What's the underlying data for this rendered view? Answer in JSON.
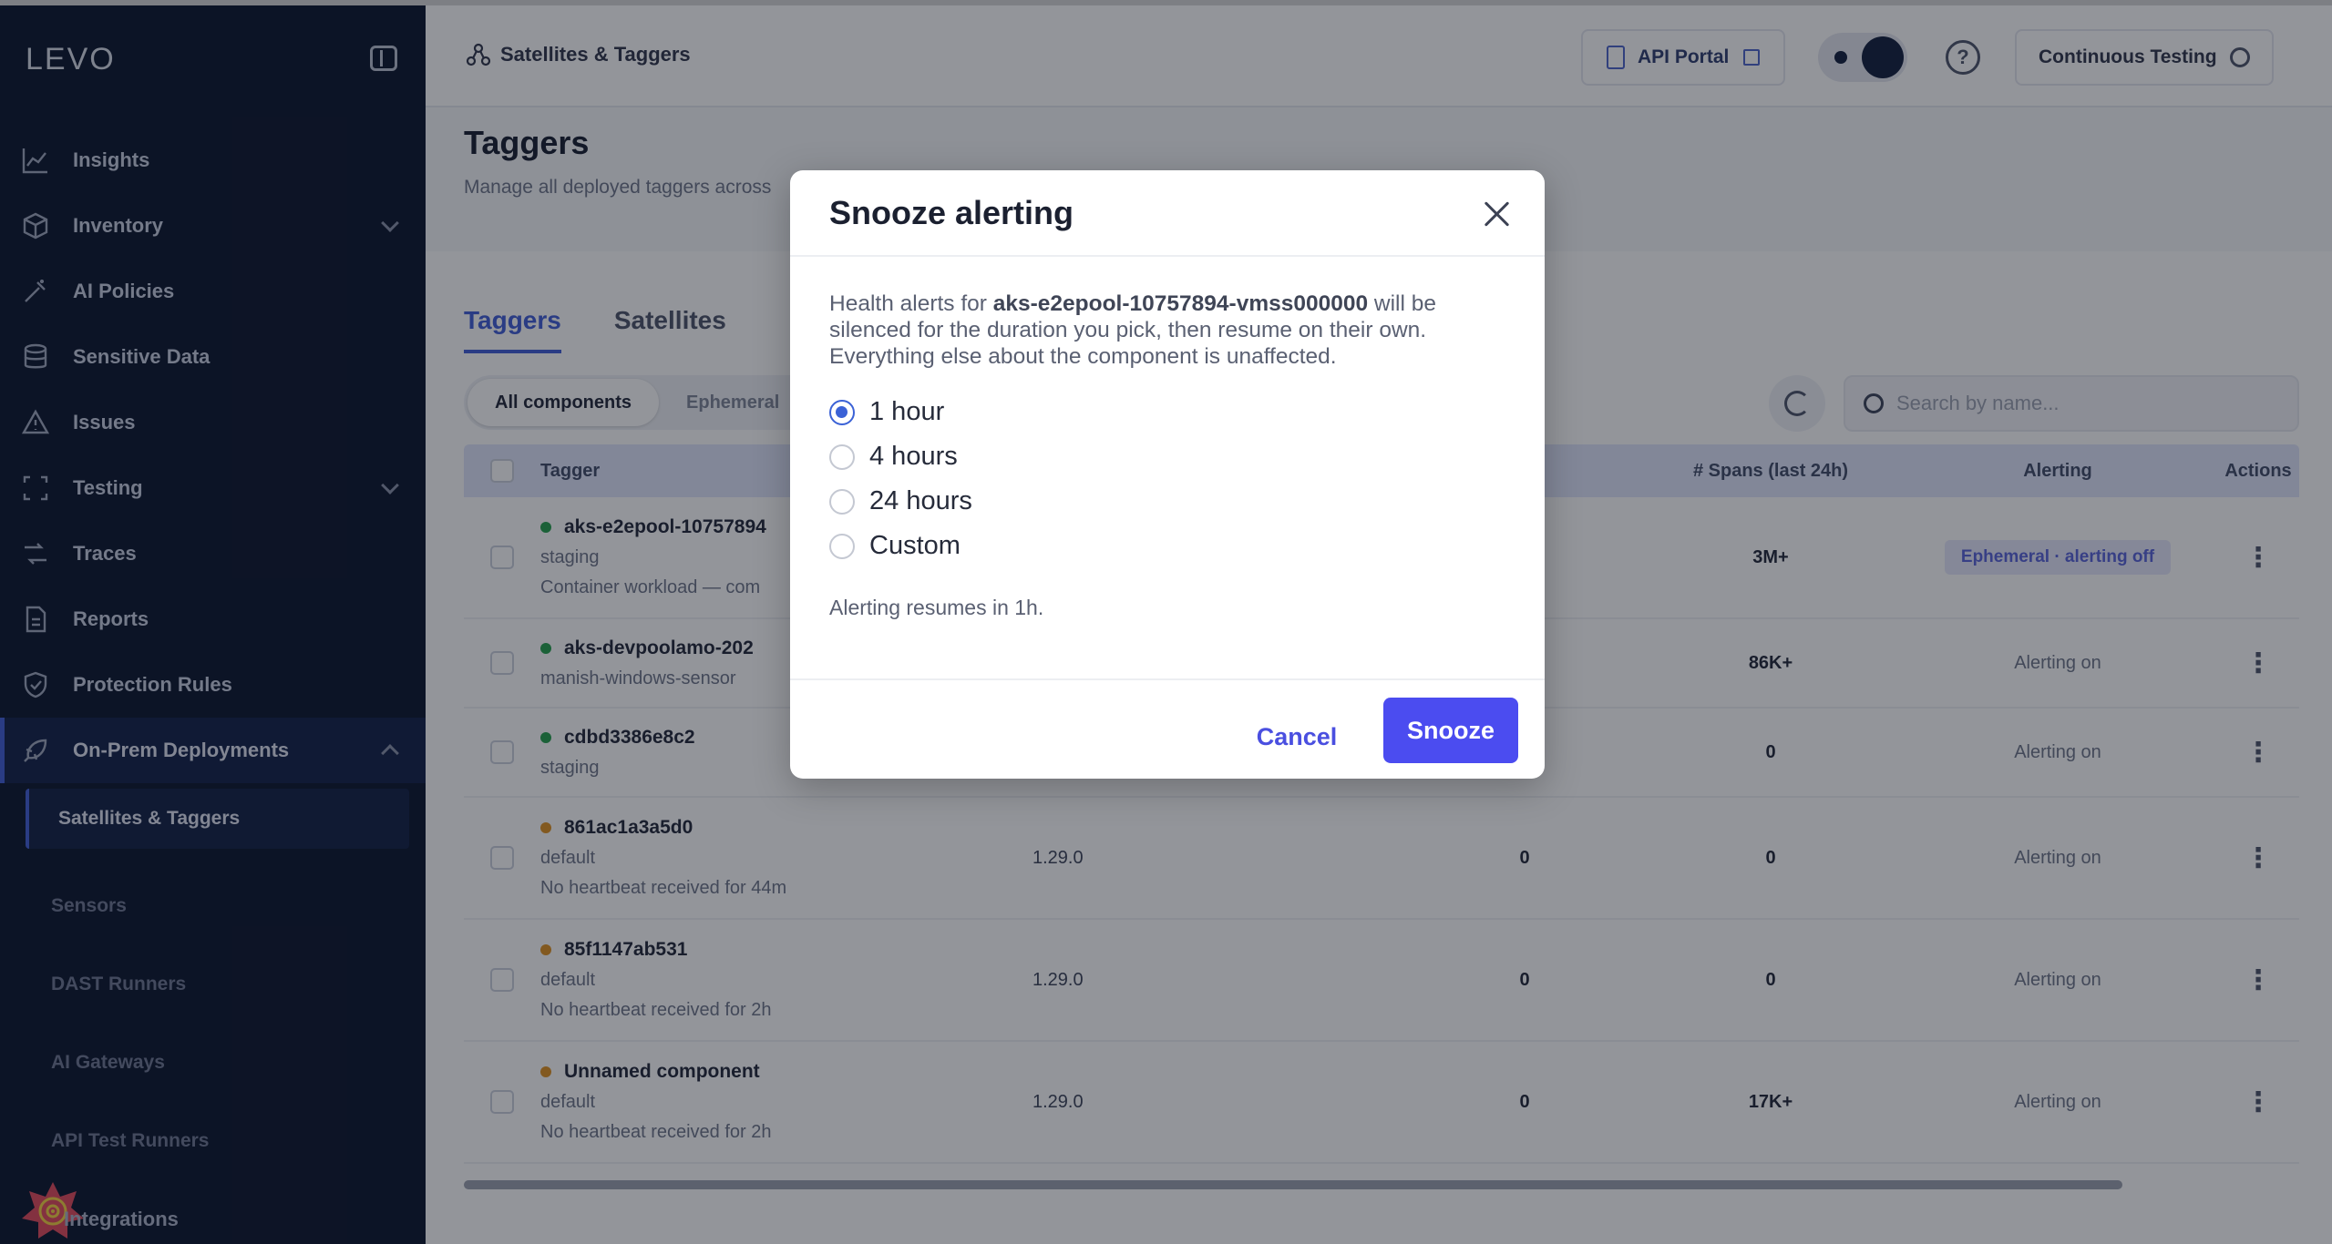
{
  "sidebar": {
    "logo": "LEVO",
    "nav": [
      {
        "label": "Insights",
        "icon": "chart-line-icon"
      },
      {
        "label": "Inventory",
        "icon": "box-icon",
        "chevron": "down"
      },
      {
        "label": "AI Policies",
        "icon": "wand-icon"
      },
      {
        "label": "Sensitive Data",
        "icon": "database-icon"
      },
      {
        "label": "Issues",
        "icon": "warning-icon"
      },
      {
        "label": "Testing",
        "icon": "scan-icon",
        "chevron": "down"
      },
      {
        "label": "Traces",
        "icon": "traces-icon"
      },
      {
        "label": "Reports",
        "icon": "report-icon"
      },
      {
        "label": "Protection Rules",
        "icon": "shield-check-icon"
      },
      {
        "label": "On-Prem Deployments",
        "icon": "rocket-icon",
        "chevron": "up"
      }
    ],
    "sub": [
      "Satellites & Taggers",
      "Sensors",
      "DAST Runners",
      "AI Gateways",
      "API Test Runners"
    ],
    "integrations": "Integrations"
  },
  "header": {
    "breadcrumb": "Satellites & Taggers",
    "api_portal": "API Portal",
    "help": "?",
    "env_button": "Continuous Testing"
  },
  "page": {
    "title": "Taggers",
    "subtitle": "Manage all deployed taggers across"
  },
  "tabs": [
    "Taggers",
    "Satellites"
  ],
  "filters": [
    "All components",
    "Ephemeral"
  ],
  "search": {
    "placeholder": "Search by name..."
  },
  "table": {
    "headers": {
      "name": "Tagger",
      "spans": "# Spans (last 24h)",
      "alerting": "Alerting",
      "actions": "Actions"
    },
    "rows": [
      {
        "name": "aks-e2epool-10757894",
        "env": "staging",
        "note": "Container workload — com",
        "version": "",
        "col_x": "",
        "spans": "3M+",
        "alerting": "Ephemeral · alerting off",
        "status": "#22a04b",
        "chip": true
      },
      {
        "name": "aks-devpoolamo-202",
        "env": "manish-windows-sensor",
        "note": "",
        "version": "",
        "col_x": "",
        "spans": "86K+",
        "alerting": "Alerting on",
        "status": "#22a04b",
        "chip": false
      },
      {
        "name": "cdbd3386e8c2",
        "env": "staging",
        "note": "",
        "version": "",
        "col_x": "",
        "spans": "0",
        "alerting": "Alerting on",
        "status": "#22a04b",
        "chip": false
      },
      {
        "name": "861ac1a3a5d0",
        "env": "default",
        "note": "No heartbeat received for 44m",
        "version": "1.29.0",
        "col_x": "0",
        "spans": "0",
        "alerting": "Alerting on",
        "status": "#e0901e",
        "chip": false
      },
      {
        "name": "85f1147ab531",
        "env": "default",
        "note": "No heartbeat received for 2h",
        "version": "1.29.0",
        "col_x": "0",
        "spans": "0",
        "alerting": "Alerting on",
        "status": "#e0901e",
        "chip": false
      },
      {
        "name": "Unnamed component",
        "env": "default",
        "note": "No heartbeat received for 2h",
        "version": "1.29.0",
        "col_x": "0",
        "spans": "17K+",
        "alerting": "Alerting on",
        "status": "#e0901e",
        "chip": false
      }
    ]
  },
  "modal": {
    "title": "Snooze alerting",
    "desc_prefix": "Health alerts for ",
    "component": "aks-e2epool-10757894-vmss000000",
    "desc_suffix": " will be silenced for the duration you pick, then resume on their own. Everything else about the component is unaffected.",
    "options": [
      {
        "label": "1 hour",
        "checked": true
      },
      {
        "label": "4 hours",
        "checked": false
      },
      {
        "label": "24 hours",
        "checked": false
      },
      {
        "label": "Custom",
        "checked": false
      }
    ],
    "resume_text": "Alerting resumes in 1h.",
    "cancel": "Cancel",
    "confirm": "Snooze"
  },
  "colors": {
    "accent": "#4b4cf0",
    "radio": "#3b62d6",
    "sidebar_bg": "#07112a"
  }
}
